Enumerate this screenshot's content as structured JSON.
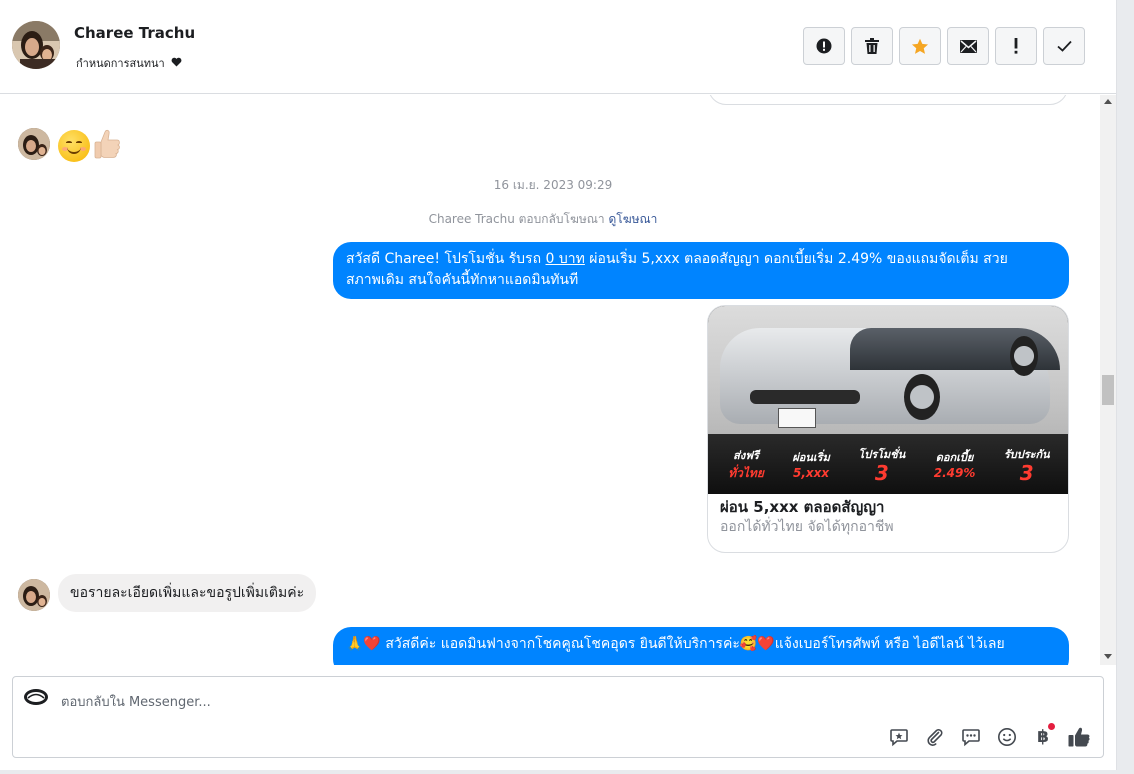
{
  "header": {
    "contact_name": "Charee Trachu",
    "assign_label": "กำหนดการสนทนา",
    "actions": [
      {
        "name": "spam-button",
        "icon": "alert-circle-icon"
      },
      {
        "name": "delete-button",
        "icon": "trash-icon"
      },
      {
        "name": "star-button",
        "icon": "star-icon",
        "color": "#f5a623"
      },
      {
        "name": "mark-unread-button",
        "icon": "envelope-icon"
      },
      {
        "name": "follow-up-button",
        "icon": "exclamation-icon"
      },
      {
        "name": "done-button",
        "icon": "check-icon"
      }
    ]
  },
  "messages": {
    "timestamp": "16 เม.ย. 2023 09:29",
    "reply_note": {
      "text": "Charee Trachu ตอบกลับโฆษณา",
      "link": "ดูโฆษณา"
    },
    "outgoing_1": {
      "part1": "สวัสดี Charee! โปรโมชั่น รับรถ ",
      "underlined": "0 บาท",
      "part2": " ผ่อนเริ่ม 5,xxx ตลอดสัญญา ดอกเบี้ยเริ่ม 2.49% ของแถมจัดเต็ม สวย",
      "line2": "สภาพเดิม สนใจคันนี้ทักหาแอดมินทันที"
    },
    "ad": {
      "promo": [
        {
          "label": "ส่งฟรี",
          "value": "ทั่วไทย"
        },
        {
          "label": "ผ่อนเริ่ม",
          "value": "5,xxx"
        },
        {
          "label": "โปรโมชั่น",
          "value": "3"
        },
        {
          "label": "ดอกเบี้ย",
          "value": "2.49%"
        },
        {
          "label": "รับประกัน",
          "value": "3"
        }
      ],
      "title": "ผ่อน 5,xxx ตลอดสัญญา",
      "subtitle": "ออกได้ทั่วไทย จัดได้ทุกอาชีพ"
    },
    "incoming_1": "ขอรายละเอียดเพิ่มและขอรูปเพิ่มเติมค่ะ",
    "outgoing_2": "🙏❤️ สวัสดีค่ะ แอดมินฟางจากโชคคูณโชคอุดร ยินดีให้บริการค่ะ🥰❤️แจ้งเบอร์โทรศัพท์ หรือ ไอดีไลน์  ไว้เลย"
  },
  "composer": {
    "placeholder": "ตอบกลับใน Messenger...",
    "tools": [
      "saved-reply-icon",
      "attach-icon",
      "quick-reply-icon",
      "emoji-icon",
      "payment-icon",
      "like-icon"
    ],
    "payment_symbol": "฿"
  },
  "colors": {
    "accent": "#0084ff",
    "incoming_bubble": "#f1f0f0",
    "star": "#f5a623",
    "link": "#385898"
  }
}
